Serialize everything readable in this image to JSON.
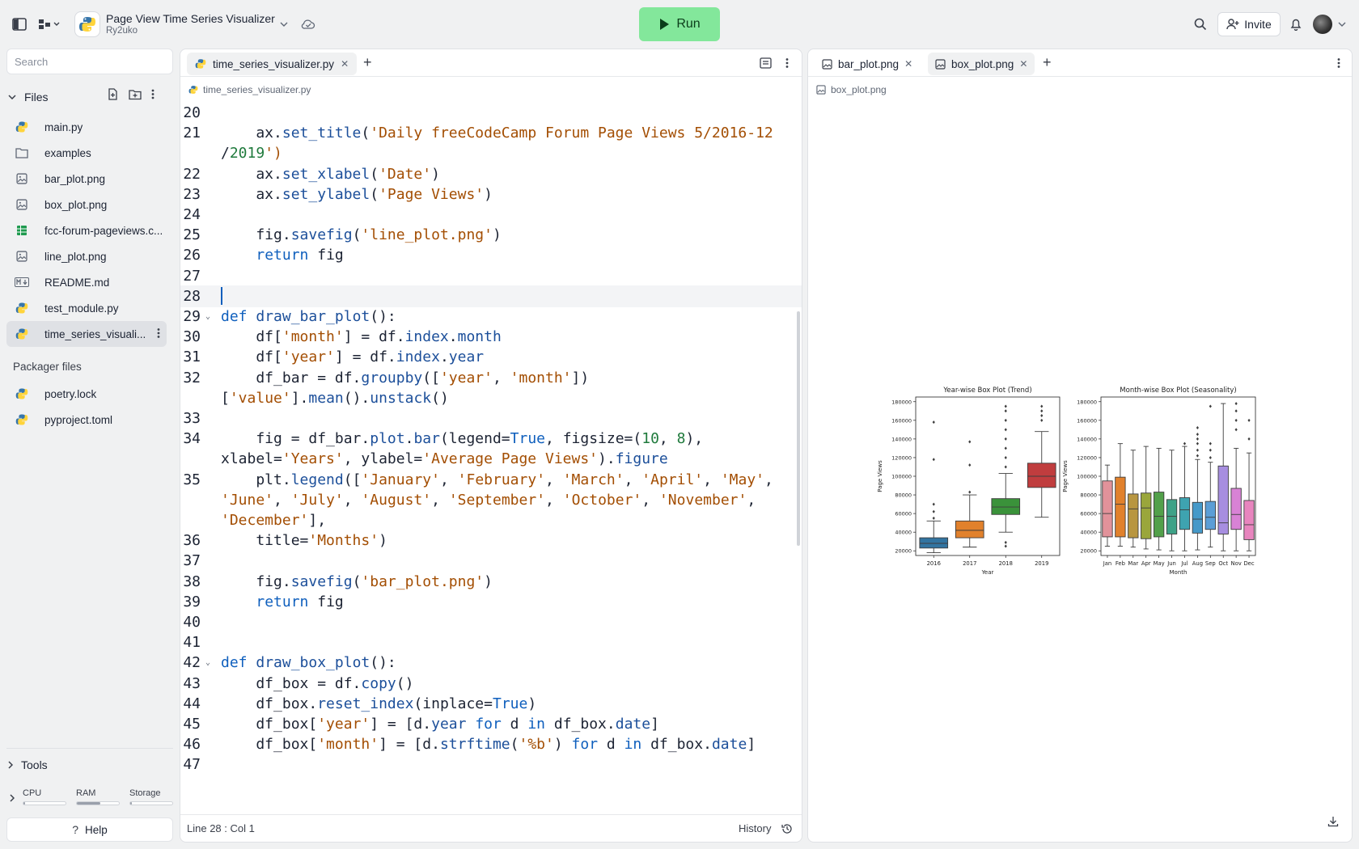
{
  "header": {
    "app_title": "Page View Time Series Visualizer",
    "owner": "Ry2uko",
    "run_label": "Run",
    "invite_label": "Invite"
  },
  "sidebar": {
    "search_placeholder": "Search",
    "files_label": "Files",
    "files": [
      {
        "name": "main.py",
        "icon": "python-icon"
      },
      {
        "name": "examples",
        "icon": "folder-icon"
      },
      {
        "name": "bar_plot.png",
        "icon": "image-icon"
      },
      {
        "name": "box_plot.png",
        "icon": "image-icon"
      },
      {
        "name": "fcc-forum-pageviews.c...",
        "icon": "spreadsheet-icon"
      },
      {
        "name": "line_plot.png",
        "icon": "image-icon"
      },
      {
        "name": "README.md",
        "icon": "markdown-icon"
      },
      {
        "name": "test_module.py",
        "icon": "python-icon"
      },
      {
        "name": "time_series_visuali...",
        "icon": "python-icon"
      }
    ],
    "packager_label": "Packager files",
    "packager_files": [
      {
        "name": "poetry.lock",
        "icon": "python-icon"
      },
      {
        "name": "pyproject.toml",
        "icon": "python-icon"
      }
    ],
    "tools_label": "Tools",
    "resources": {
      "cpu_label": "CPU",
      "ram_label": "RAM",
      "storage_label": "Storage",
      "cpu": 0.04,
      "ram": 0.55,
      "storage": 0.03
    },
    "help_label": "Help"
  },
  "editor": {
    "tab_label": "time_series_visualizer.py",
    "breadcrumb": "time_series_visualizer.py",
    "status_position": "Line 28 : Col 1",
    "history_label": "History",
    "lines": [
      {
        "n": "20",
        "text": ""
      },
      {
        "n": "21",
        "text": "    ax.set_title('Daily freeCodeCamp Forum Page Views 5/2016-12"
      },
      {
        "n": "",
        "text": "/2019')"
      },
      {
        "n": "22",
        "text": "    ax.set_xlabel('Date')"
      },
      {
        "n": "23",
        "text": "    ax.set_ylabel('Page Views')"
      },
      {
        "n": "24",
        "text": ""
      },
      {
        "n": "25",
        "text": "    fig.savefig('line_plot.png')"
      },
      {
        "n": "26",
        "text": "    return fig"
      },
      {
        "n": "27",
        "text": ""
      },
      {
        "n": "28",
        "text": ""
      },
      {
        "n": "29",
        "text": "def draw_bar_plot():"
      },
      {
        "n": "30",
        "text": "    df['month'] = df.index.month"
      },
      {
        "n": "31",
        "text": "    df['year'] = df.index.year"
      },
      {
        "n": "32",
        "text": "    df_bar = df.groupby(['year', 'month'])"
      },
      {
        "n": "",
        "text": "['value'].mean().unstack()"
      },
      {
        "n": "33",
        "text": ""
      },
      {
        "n": "34",
        "text": "    fig = df_bar.plot.bar(legend=True, figsize=(10, 8),"
      },
      {
        "n": "",
        "text": "xlabel='Years', ylabel='Average Page Views').figure"
      },
      {
        "n": "35",
        "text": "    plt.legend(['January', 'February', 'March', 'April', 'May',"
      },
      {
        "n": "",
        "text": "'June', 'July', 'August', 'September', 'October', 'November',"
      },
      {
        "n": "",
        "text": "'December'],"
      },
      {
        "n": "36",
        "text": "    title='Months')"
      },
      {
        "n": "37",
        "text": ""
      },
      {
        "n": "38",
        "text": "    fig.savefig('bar_plot.png')"
      },
      {
        "n": "39",
        "text": "    return fig"
      },
      {
        "n": "40",
        "text": ""
      },
      {
        "n": "41",
        "text": ""
      },
      {
        "n": "42",
        "text": "def draw_box_plot():"
      },
      {
        "n": "43",
        "text": "    df_box = df.copy()"
      },
      {
        "n": "44",
        "text": "    df_box.reset_index(inplace=True)"
      },
      {
        "n": "45",
        "text": "    df_box['year'] = [d.year for d in df_box.date]"
      },
      {
        "n": "46",
        "text": "    df_box['month'] = [d.strftime('%b') for d in df_box.date]"
      },
      {
        "n": "47",
        "text": ""
      }
    ]
  },
  "viewer": {
    "tabs": [
      "bar_plot.png",
      "box_plot.png"
    ],
    "breadcrumb": "box_plot.png"
  },
  "chart_data": [
    {
      "type": "box",
      "title": "Year-wise Box Plot (Trend)",
      "xlabel": "Year",
      "ylabel": "Page Views",
      "ylim": [
        15000,
        185000
      ],
      "yticks": [
        20000,
        40000,
        60000,
        80000,
        100000,
        120000,
        140000,
        160000,
        180000
      ],
      "categories": [
        "2016",
        "2017",
        "2018",
        "2019"
      ],
      "colors": [
        "#3274a1",
        "#e1812c",
        "#3a923a",
        "#c03d3e"
      ],
      "boxes": [
        {
          "min": 18000,
          "q1": 23000,
          "median": 28000,
          "q3": 34000,
          "max": 52000,
          "outliers": [
            55000,
            62000,
            70000,
            118000,
            158000
          ]
        },
        {
          "min": 24000,
          "q1": 34000,
          "median": 42000,
          "q3": 52000,
          "max": 80000,
          "outliers": [
            83000,
            112000,
            137000
          ]
        },
        {
          "min": 40000,
          "q1": 59000,
          "median": 67000,
          "q3": 76000,
          "max": 103000,
          "outliers": [
            25000,
            29000,
            110000,
            120000,
            130000,
            140000,
            150000,
            160000,
            170000,
            175000
          ]
        },
        {
          "min": 56000,
          "q1": 88000,
          "median": 100000,
          "q3": 114000,
          "max": 148000,
          "outliers": [
            160000,
            165000,
            170000,
            175000
          ]
        }
      ]
    },
    {
      "type": "box",
      "title": "Month-wise Box Plot (Seasonality)",
      "xlabel": "Month",
      "ylabel": "Page Views",
      "ylim": [
        15000,
        185000
      ],
      "yticks": [
        20000,
        40000,
        60000,
        80000,
        100000,
        120000,
        140000,
        160000,
        180000
      ],
      "categories": [
        "Jan",
        "Feb",
        "Mar",
        "Apr",
        "May",
        "Jun",
        "Jul",
        "Aug",
        "Sep",
        "Oct",
        "Nov",
        "Dec"
      ],
      "colors": [
        "#e1929a",
        "#e1812c",
        "#b89640",
        "#9aa63b",
        "#52a04a",
        "#3ea287",
        "#3ea3b0",
        "#4599c9",
        "#5b9ed6",
        "#a78ee0",
        "#d882d5",
        "#e885be"
      ],
      "boxes": [
        {
          "min": 25000,
          "q1": 35000,
          "median": 60000,
          "q3": 95000,
          "max": 112000,
          "outliers": []
        },
        {
          "min": 25000,
          "q1": 35000,
          "median": 70000,
          "q3": 99000,
          "max": 135000,
          "outliers": []
        },
        {
          "min": 24000,
          "q1": 34000,
          "median": 65000,
          "q3": 81000,
          "max": 128000,
          "outliers": []
        },
        {
          "min": 22000,
          "q1": 33000,
          "median": 66000,
          "q3": 82000,
          "max": 132000,
          "outliers": []
        },
        {
          "min": 21000,
          "q1": 35000,
          "median": 57000,
          "q3": 83000,
          "max": 130000,
          "outliers": []
        },
        {
          "min": 20000,
          "q1": 38000,
          "median": 57000,
          "q3": 75000,
          "max": 128000,
          "outliers": []
        },
        {
          "min": 20000,
          "q1": 43000,
          "median": 64000,
          "q3": 77000,
          "max": 132000,
          "outliers": [
            135000
          ]
        },
        {
          "min": 21000,
          "q1": 39000,
          "median": 54000,
          "q3": 72000,
          "max": 118000,
          "outliers": [
            122000,
            128000,
            135000,
            140000,
            145000,
            152000
          ]
        },
        {
          "min": 24000,
          "q1": 43000,
          "median": 56000,
          "q3": 73000,
          "max": 115000,
          "outliers": [
            120000,
            128000,
            135000,
            175000
          ]
        },
        {
          "min": 20000,
          "q1": 38000,
          "median": 50000,
          "q3": 111000,
          "max": 178000,
          "outliers": []
        },
        {
          "min": 20000,
          "q1": 43000,
          "median": 59000,
          "q3": 87000,
          "max": 130000,
          "outliers": [
            150000,
            160000,
            170000,
            178000
          ]
        },
        {
          "min": 20000,
          "q1": 32000,
          "median": 48000,
          "q3": 74000,
          "max": 125000,
          "outliers": [
            140000,
            160000
          ]
        }
      ]
    }
  ]
}
